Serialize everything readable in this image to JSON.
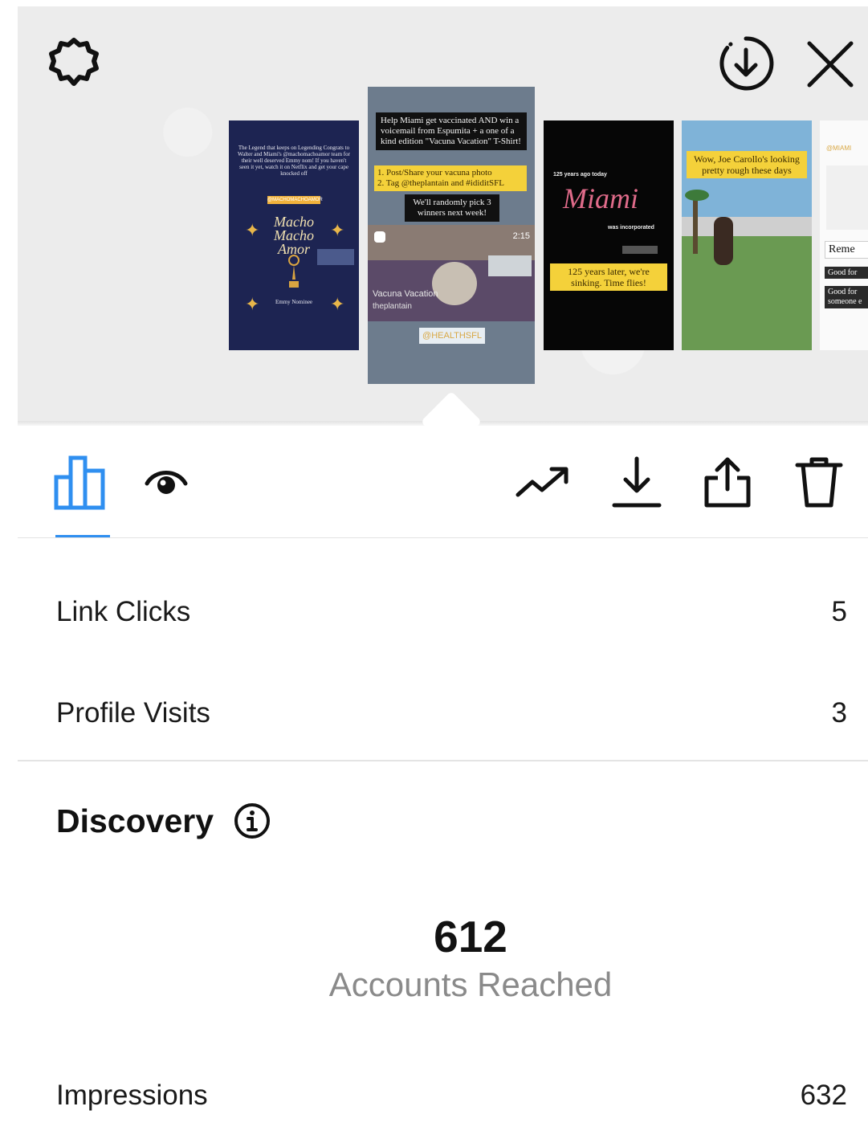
{
  "stories": [
    {
      "id_label": "story-1",
      "text": "The Legend that keeps on Legending Congrats to Walter and Miami's @machomachoamor team for their well deserved Emmy nom! If you haven't seen it yet, watch it on Netflix and get your cape knocked off",
      "tag": "@MACHOMACHOAMOR",
      "title": "Macho Macho Amor",
      "caption": "Emmy Nominee"
    },
    {
      "id_label": "story-2",
      "headline": "Help Miami get vaccinated AND win a voicemail from Espumita + a one of a kind edition \"Vacuna Vacation\" T-Shirt!",
      "steps": "1. Post/Share your vacuna photo\n2. Tag @theplantain and #ididitSFL",
      "note": "We'll randomly pick 3 winners next week!",
      "video_title": "Vacuna Vacation",
      "video_author": "theplantain",
      "duration": "2:15",
      "tag": "@HEALTHSFL"
    },
    {
      "id_label": "story-3",
      "pre": "125 years ago today",
      "city": "Miami",
      "post": "was incorporated",
      "caption": "125 years later, we're sinking. Time flies!"
    },
    {
      "id_label": "story-4",
      "caption": "Wow, Joe Carollo's looking pretty rough these days"
    },
    {
      "id_label": "story-5",
      "tag": "@MIAMI",
      "line1": "Reme",
      "line2": "Good for",
      "line3": "Good for someone e"
    }
  ],
  "stats": {
    "link_clicks_label": "Link Clicks",
    "link_clicks_value": "5",
    "profile_visits_label": "Profile Visits",
    "profile_visits_value": "3"
  },
  "discovery": {
    "title": "Discovery",
    "accounts_reached_value": "612",
    "accounts_reached_label": "Accounts Reached",
    "impressions_label": "Impressions",
    "impressions_value": "632"
  },
  "colors": {
    "accent": "#2f8ff0"
  }
}
